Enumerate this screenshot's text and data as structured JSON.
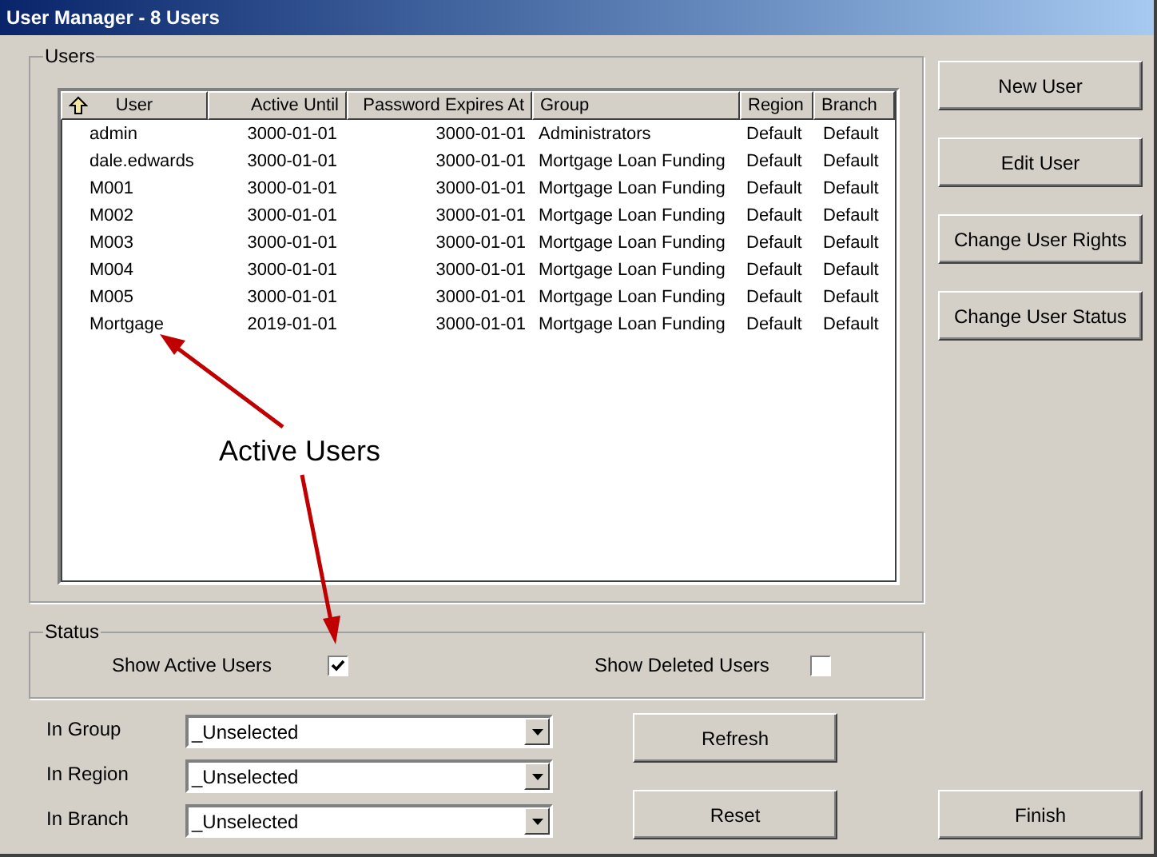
{
  "window": {
    "title": "User Manager - 8 Users"
  },
  "users_group": {
    "label": "Users"
  },
  "table": {
    "columns": [
      "User",
      "Active Until",
      "Password Expires At",
      "Group",
      "Region",
      "Branch"
    ],
    "rows": [
      [
        "admin",
        "3000-01-01",
        "3000-01-01",
        "Administrators",
        "Default",
        "Default"
      ],
      [
        "dale.edwards",
        "3000-01-01",
        "3000-01-01",
        "Mortgage Loan Funding",
        "Default",
        "Default"
      ],
      [
        "M001",
        "3000-01-01",
        "3000-01-01",
        "Mortgage Loan Funding",
        "Default",
        "Default"
      ],
      [
        "M002",
        "3000-01-01",
        "3000-01-01",
        "Mortgage Loan Funding",
        "Default",
        "Default"
      ],
      [
        "M003",
        "3000-01-01",
        "3000-01-01",
        "Mortgage Loan Funding",
        "Default",
        "Default"
      ],
      [
        "M004",
        "3000-01-01",
        "3000-01-01",
        "Mortgage Loan Funding",
        "Default",
        "Default"
      ],
      [
        "M005",
        "3000-01-01",
        "3000-01-01",
        "Mortgage Loan Funding",
        "Default",
        "Default"
      ],
      [
        "Mortgage",
        "2019-01-01",
        "3000-01-01",
        "Mortgage Loan Funding",
        "Default",
        "Default"
      ]
    ]
  },
  "annotation": {
    "text": "Active Users"
  },
  "status_group": {
    "label": "Status",
    "options": [
      {
        "label": "Show Active Users",
        "checked": true
      },
      {
        "label": "Show Deleted Users",
        "checked": false
      }
    ]
  },
  "filters": [
    {
      "label": "In Group",
      "value": "_Unselected"
    },
    {
      "label": "In Region",
      "value": "_Unselected"
    },
    {
      "label": "In Branch",
      "value": "_Unselected"
    }
  ],
  "side_buttons": [
    "New User",
    "Edit User",
    "Change User Rights",
    "Change User Status"
  ],
  "filter_buttons": [
    "Refresh",
    "Reset"
  ],
  "finish_button": "Finish"
}
